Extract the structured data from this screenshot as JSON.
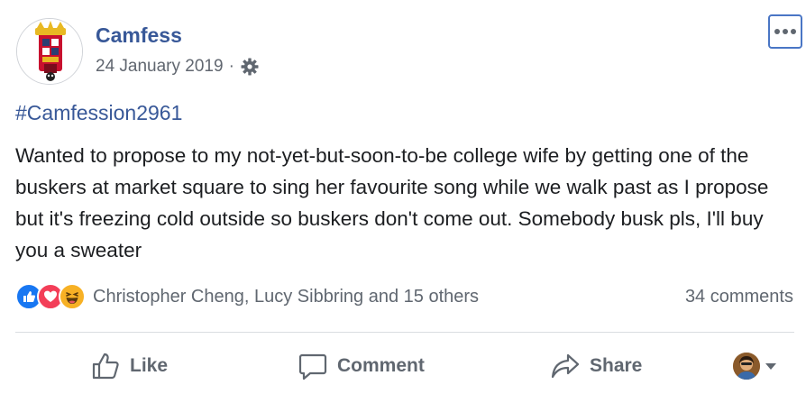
{
  "post": {
    "author": "Camfess",
    "date": "24 January 2019",
    "separator": "·",
    "audience_icon": "gear-icon",
    "hashtag": "#Camfession2961",
    "text": "Wanted to propose to my not-yet-but-soon-to-be college wife by getting one of the buskers at market square to sing her favourite song while we walk past as I propose but it's freezing cold outside so buskers don't come out. Somebody busk pls, I'll buy you a sweater"
  },
  "reactions": {
    "icons": [
      "like-reaction-icon",
      "love-reaction-icon",
      "haha-reaction-icon"
    ],
    "names": "Christopher Cheng, Lucy Sibbring and 15 others",
    "comments": "34 comments"
  },
  "actions": {
    "like": "Like",
    "comment": "Comment",
    "share": "Share"
  },
  "colors": {
    "link": "#385898",
    "secondary_text": "#606770",
    "like_blue": "#1877f2",
    "love_red": "#f33e58",
    "haha_yellow": "#f7b125"
  }
}
